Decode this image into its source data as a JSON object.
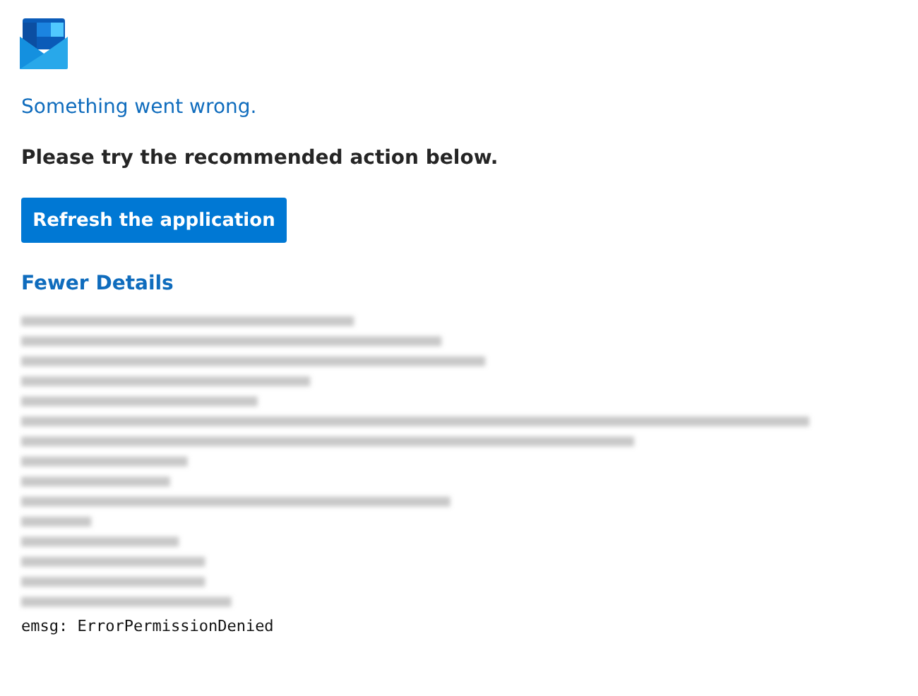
{
  "error": {
    "title": "Something went wrong.",
    "message": "Please try the recommended action below.",
    "action_button": "Refresh the application",
    "details_link": "Fewer Details"
  },
  "details": {
    "last_line": "emsg: ErrorPermissionDenied"
  }
}
